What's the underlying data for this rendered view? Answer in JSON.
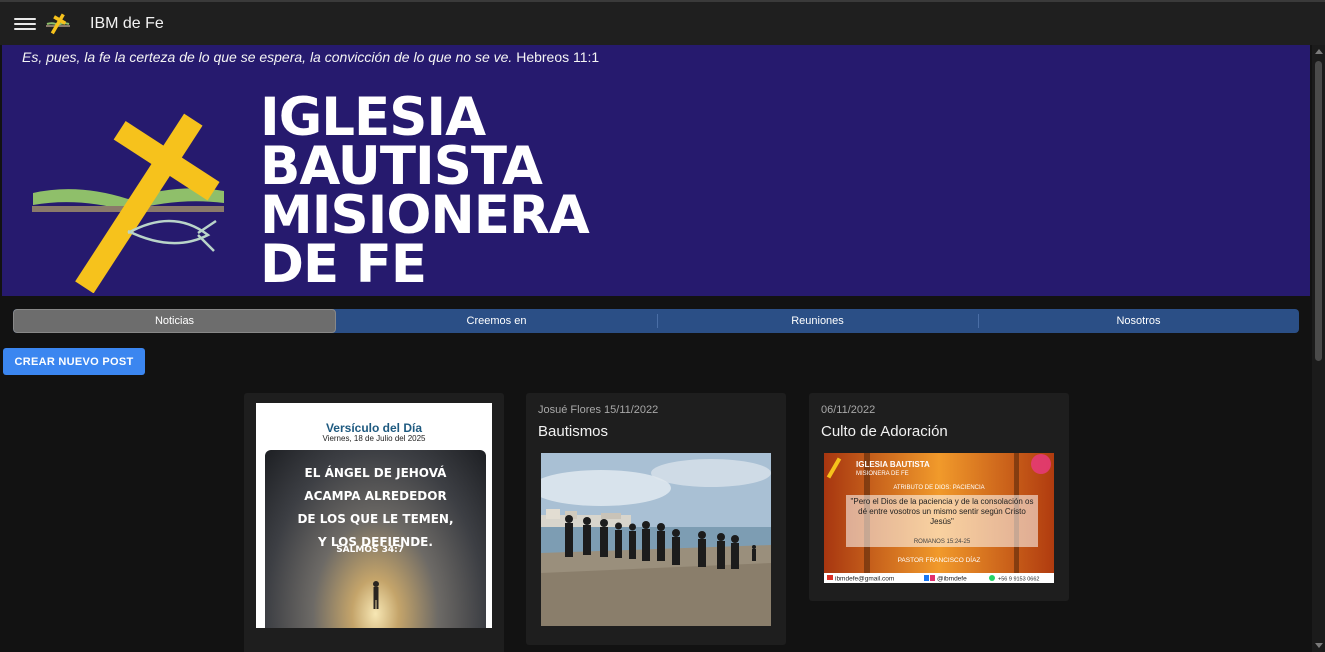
{
  "app": {
    "title": "IBM de Fe"
  },
  "banner": {
    "verse_text": "Es, pues, la fe la certeza de lo que se espera, la convicción de lo que no se ve.",
    "verse_ref": "Hebreos 11:1",
    "church_name_lines": [
      "IGLESIA",
      "BAUTISTA",
      "MISIONERA",
      "DE FE"
    ],
    "colors": {
      "background": "#261a6e",
      "cross": "#f6c21c",
      "book_green": "#8fbf6a"
    }
  },
  "tabs": [
    {
      "label": "Noticias",
      "active": true
    },
    {
      "label": "Creemos en",
      "active": false
    },
    {
      "label": "Reuniones",
      "active": false
    },
    {
      "label": "Nosotros",
      "active": false
    }
  ],
  "create_button": {
    "label": "CREAR NUEVO POST"
  },
  "posts": [
    {
      "type": "image-card",
      "image": {
        "heading": "Versículo del Día",
        "date": "Viernes, 18 de Julio del 2025",
        "verse_lines": [
          "EL ÁNGEL DE JEHOVÁ",
          "ACAMPA ALREDEDOR",
          "DE LOS QUE LE TEMEN,",
          "Y LOS DEFIENDE."
        ],
        "verse_ref": "SALMOS 34:7"
      }
    },
    {
      "type": "post",
      "meta": "Josué Flores 15/11/2022",
      "title": "Bautismos",
      "image_alt": "group-on-beach-photo"
    },
    {
      "type": "post",
      "meta": "06/11/2022",
      "title": "Culto de Adoración",
      "poster": {
        "church_line1": "IGLESIA BAUTISTA",
        "church_line2": "MISIONERA DE FE",
        "subtitle": "ATRIBUTO DE DIOS: PACIENCIA",
        "quote": "\"Pero el Dios de la paciencia y de la consolación os dé entre vosotros un mismo sentir según Cristo Jesús\"",
        "ref": "ROMANOS 15:24-25",
        "pastor": "PASTOR FRANCISCO DÍAZ",
        "contact_email": "ibmdefe@gmail.com",
        "contact_social": "@ibmdefe",
        "contact_phone": "+56 9 9153 0662"
      }
    }
  ],
  "colors": {
    "tab_bar": "#2b4f86",
    "active_tab": "#6d6d6d",
    "primary_button": "#3b86f0",
    "card_bg": "#1e1e1e",
    "page_bg": "#121212"
  }
}
